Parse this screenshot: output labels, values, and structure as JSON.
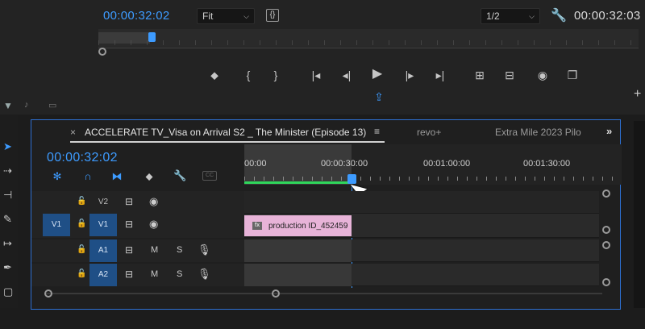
{
  "program_monitor": {
    "timecode_left": "00:00:32:02",
    "fit_select": "Fit",
    "resolution_select": "1/2",
    "timecode_right": "00:00:32:03",
    "playhead_fraction": 0.2
  },
  "timeline": {
    "tabs": [
      {
        "label": "ACCELERATE TV_Visa on Arrival S2 _ The Minister (Episode 13)",
        "active": true
      },
      {
        "label": "revo+",
        "active": false
      },
      {
        "label": "Extra Mile 2023 Pilo",
        "active": false
      }
    ],
    "timecode": "00:00:32:02",
    "ruler_labels": [
      "00:00",
      "00:00:30:00",
      "00:01:00:00",
      "00:01:30:00"
    ],
    "tracks": {
      "v2": {
        "label": "V2"
      },
      "v1": {
        "source": "V1",
        "label": "V1"
      },
      "a1": {
        "label": "A1",
        "mute": "M",
        "solo": "S"
      },
      "a2": {
        "label": "A2",
        "mute": "M",
        "solo": "S"
      }
    },
    "clip": {
      "label": "production ID_452459",
      "fx": "fx"
    },
    "toolbar": {
      "cc": "CC"
    }
  },
  "colors": {
    "accent_blue": "#3d9bff",
    "panel_border": "#2d6fd1",
    "clip_pink": "#e7b3d8",
    "track_blue": "#1f4f86",
    "work_area_green": "#2fd65b"
  }
}
